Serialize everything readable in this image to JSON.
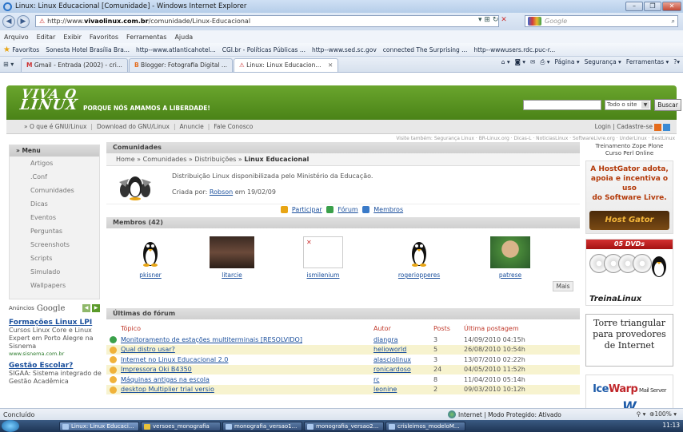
{
  "window": {
    "title": "Linux: Linux Educacional [Comunidade] - Windows Internet Explorer"
  },
  "address": {
    "prefix": "http://www.",
    "domain": "vivaolinux.com.br",
    "path": "/comunidade/Linux-Educacional",
    "search_placeholder": "Google"
  },
  "menu": [
    "Arquivo",
    "Editar",
    "Exibir",
    "Favoritos",
    "Ferramentas",
    "Ajuda"
  ],
  "favorites": {
    "label": "Favoritos",
    "items": [
      "Sonesta Hotel Brasília Bra...",
      "http--www.atlanticahotel...",
      "CGI.br - Políticas Públicas ...",
      "http--www.sed.sc.gov",
      "connected The Surprising ...",
      "http--wwwusers.rdc.puc-r..."
    ]
  },
  "tabs": [
    "Gmail - Entrada (2002) - cri...",
    "Blogger: Fotografia Digital ...",
    "Linux: Linux Educacion..."
  ],
  "commandbar": [
    "Página ▾",
    "Segurança ▾",
    "Ferramentas ▾"
  ],
  "site": {
    "logo_top": "VIVA O",
    "logo_bottom": "LINUX",
    "slogan": "PORQUE NÓS AMAMOS A LIBERDADE!",
    "search_select": "Todo o site",
    "search_button": "Buscar",
    "nav": [
      "» O que é GNU/Linux",
      "Download do GNU/Linux",
      "Anuncie",
      "Fale Conosco"
    ],
    "login": "Login",
    "signup": "Cadastre-se",
    "visit": "Visite também: Segurança Linux · BR-Linux.org · Dicas-L · NoticiasLinux · SoftwareLivre.org · UnderLinux · BestLinux"
  },
  "sidemenu": {
    "title": "» Menu",
    "items": [
      "Artigos",
      ".Conf",
      "Comunidades",
      "Dicas",
      "Eventos",
      "Perguntas",
      "Screenshots",
      "Scripts",
      "Simulado",
      "Wallpapers"
    ]
  },
  "ads": {
    "label": "Anúncios",
    "brand": "Google",
    "items": [
      {
        "title": "Formações Linux LPI",
        "desc": "Cursos Linux Core e Linux Expert em Porto Alegre na Sisnema",
        "url": "www.sisnema.com.br"
      },
      {
        "title": "Gestão Escolar?",
        "desc": "SIGAA: Sistema integrado de Gestão Acadêmica",
        "url": ""
      }
    ]
  },
  "community": {
    "section": "Comunidades",
    "crumb_prefix": "Home » Comunidades » Distribuições » ",
    "crumb_current": "Linux Educacional",
    "description": "Distribuição Linux disponibilizada pelo Ministério da Educação.",
    "created_prefix": "Criada por: ",
    "created_by": "Robson",
    "created_suffix": " em 19/02/09",
    "actions": [
      "Participar",
      "Fórum",
      "Membros"
    ]
  },
  "members": {
    "title": "Membros (42)",
    "more": "Mais",
    "list": [
      "pkisner",
      "litarcie",
      "ismilenium",
      "rogeriopperes",
      "patrese"
    ]
  },
  "forum": {
    "title": "Últimas do fórum",
    "headers": [
      "Tópico",
      "Autor",
      "Posts",
      "Última postagem"
    ],
    "rows": [
      {
        "topic": "Monitoramento de estações multiterminais [RESOLVIDO]",
        "author": "diangra",
        "posts": "3",
        "last": "14/09/2010 04:15h"
      },
      {
        "topic": "Qual distro usar?",
        "author": "helioworld",
        "posts": "5",
        "last": "26/08/2010 10:54h"
      },
      {
        "topic": "Internet no Linux Educacional 2.0",
        "author": "alasciolinux",
        "posts": "3",
        "last": "13/07/2010 02:22h"
      },
      {
        "topic": "Impressora Oki B4350",
        "author": "ronicardoso",
        "posts": "24",
        "last": "04/05/2010 11:52h"
      },
      {
        "topic": "Máquinas antigas na escola",
        "author": "rc",
        "posts": "8",
        "last": "11/04/2010 05:14h"
      },
      {
        "topic": "desktop Multiplier trial versio",
        "author": "leonine",
        "posts": "2",
        "last": "09/03/2010 10:12h"
      }
    ]
  },
  "right": {
    "treino": "Treinamento Zope Plone",
    "treino2": "Curso Perl Online",
    "hg_line1": "A HostGator adota,",
    "hg_line2": "apoia e incentiva o uso",
    "hg_line3": "do Software Livre.",
    "hg_logo": "Host Gator",
    "dvds_title": "05 DVDs",
    "dvds_brand": "TreinaLinux",
    "torre": "Torre triangular para provedores de Internet",
    "ice_a": "Ice",
    "ice_b": "Warp",
    "ice_c": " Mail Server"
  },
  "status": {
    "left": "Concluído",
    "zone": "Internet | Modo Protegido: Ativado",
    "zoom": "100%"
  },
  "taskbar": {
    "items": [
      "Linux: Linux Educaci...",
      "versoes_monografia",
      "monografia_versao1...",
      "monografia_versao2...",
      "crisleimos_modeloM..."
    ],
    "clock": "11:13"
  }
}
